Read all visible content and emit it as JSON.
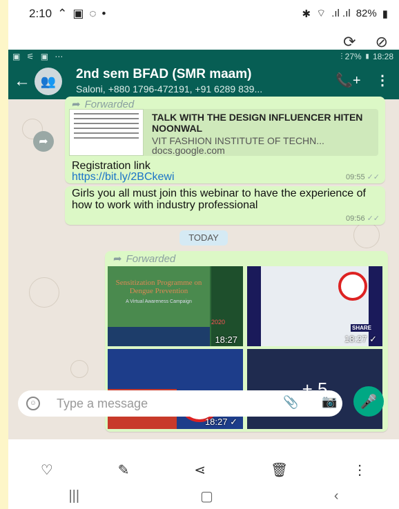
{
  "outer_status": {
    "time": "2:10",
    "icons": [
      "signal-up-icon",
      "gallery-icon",
      "whatsapp-icon",
      "dot-icon"
    ],
    "battery": "82%"
  },
  "inner_status": {
    "left_icons": "▣ ⚟ ▣ ⋯",
    "right_text": "⫶ 27% ▮ 18:28"
  },
  "header": {
    "title": "2nd sem BFAD (SMR maam)",
    "subtitle": "Saloni, +880 1796-472191, +91 6289 839..."
  },
  "messages": {
    "msg1": {
      "forwarded": "Forwarded",
      "preview_title": "TALK WITH THE DESIGN INFLUENCER HITEN NOONWAL",
      "preview_desc": "VIT FASHION INSTITUTE OF TECHN...",
      "preview_domain": "docs.google.com",
      "text": "Registration link",
      "link": "https://bit.ly/2BCkewi",
      "time": "09:55"
    },
    "msg2": {
      "text": "Girls you all must join this webinar to have the experience of how to work with industry professional",
      "time": "09:56"
    },
    "date_divider": "TODAY",
    "msg3": {
      "forwarded": "Forwarded",
      "photos": [
        {
          "time": "18:27",
          "title": "Sensitization Programme on Dengue Prevention",
          "subtitle": "A Virtual Awareness Campaign",
          "year": "2020"
        },
        {
          "time": "18:27",
          "label": "SHARE"
        },
        {
          "time": "18:27"
        },
        {
          "more": "+ 5"
        }
      ]
    }
  },
  "input": {
    "placeholder": "Type a message"
  },
  "colors": {
    "header": "#075e54",
    "bubble": "#dcf8c6",
    "chat_bg": "#ece5dd",
    "accent": "#00a884",
    "link": "#1a73c8"
  }
}
